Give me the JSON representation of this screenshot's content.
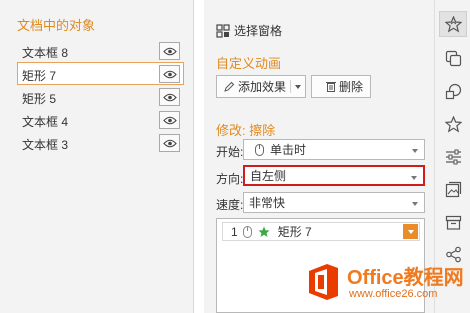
{
  "objects_panel": {
    "title": "文档中的对象",
    "items": [
      {
        "label": "文本框 8",
        "selected": false
      },
      {
        "label": "矩形 7",
        "selected": true
      },
      {
        "label": "矩形 5",
        "selected": false
      },
      {
        "label": "文本框 4",
        "selected": false
      },
      {
        "label": "文本框 3",
        "selected": false
      }
    ]
  },
  "pane": {
    "header": "选择窗格",
    "custom_animation_title": "自定义动画",
    "add_effect_label": "添加效果",
    "delete_label": "删除",
    "modify_title": "修改: 擦除",
    "start_label": "开始:",
    "start_value": "单击时",
    "direction_label": "方向:",
    "direction_value": "自左侧",
    "speed_label": "速度:",
    "speed_value": "非常快",
    "animation_list": [
      {
        "index": "1",
        "name": "矩形 7"
      }
    ]
  },
  "toolbar": {
    "icons": [
      "animation-star-icon",
      "copy-layers-icon",
      "shapes-icon",
      "star-outline-icon",
      "sliders-icon",
      "image-icon",
      "archive-box-icon",
      "share-icon"
    ]
  },
  "watermark": {
    "title": "Office教程网",
    "url": "www.office26.com"
  },
  "colors": {
    "accent": "#e08a1e",
    "highlight_border": "#d41b1b",
    "panel_bg": "#f3f3f3"
  }
}
